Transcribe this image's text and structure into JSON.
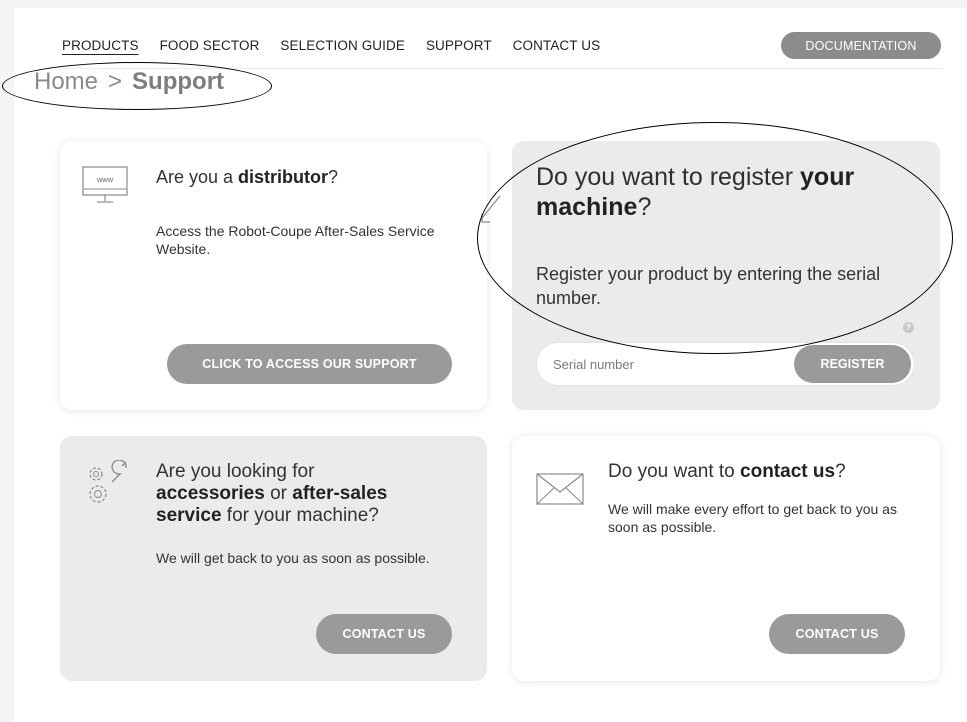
{
  "nav": {
    "items": [
      "PRODUCTS",
      "FOOD SECTOR",
      "SELECTION GUIDE",
      "SUPPORT",
      "CONTACT US"
    ],
    "documentation": "DOCUMENTATION"
  },
  "breadcrumb": {
    "home": "Home",
    "separator": ">",
    "current": "Support"
  },
  "distributor": {
    "title_prefix": "Are you a ",
    "title_bold": "distributor",
    "title_suffix": "?",
    "text": "Access the Robot-Coupe After-Sales Service Website.",
    "button": "CLICK TO ACCESS OUR SUPPORT",
    "icon_label": "www"
  },
  "register": {
    "title_prefix": "Do you want to register ",
    "title_bold_1": "your",
    "title_bold_2": "machine",
    "title_suffix": "?",
    "text": "Register your product by entering the serial number.",
    "placeholder": "Serial number",
    "button": "REGISTER",
    "help": "?"
  },
  "accessories": {
    "line1": "Are you looking for",
    "bold1": "accessories",
    "mid": " or ",
    "bold2": "after-sales",
    "bold3": "service",
    "end": " for your machine?",
    "text": "We will get back to you as soon as possible.",
    "button": "CONTACT US"
  },
  "contact": {
    "title_prefix": "Do you want to ",
    "title_bold": "contact us",
    "title_suffix": "?",
    "text": "We will make every effort to get back to you as soon as possible.",
    "button": "CONTACT US"
  }
}
